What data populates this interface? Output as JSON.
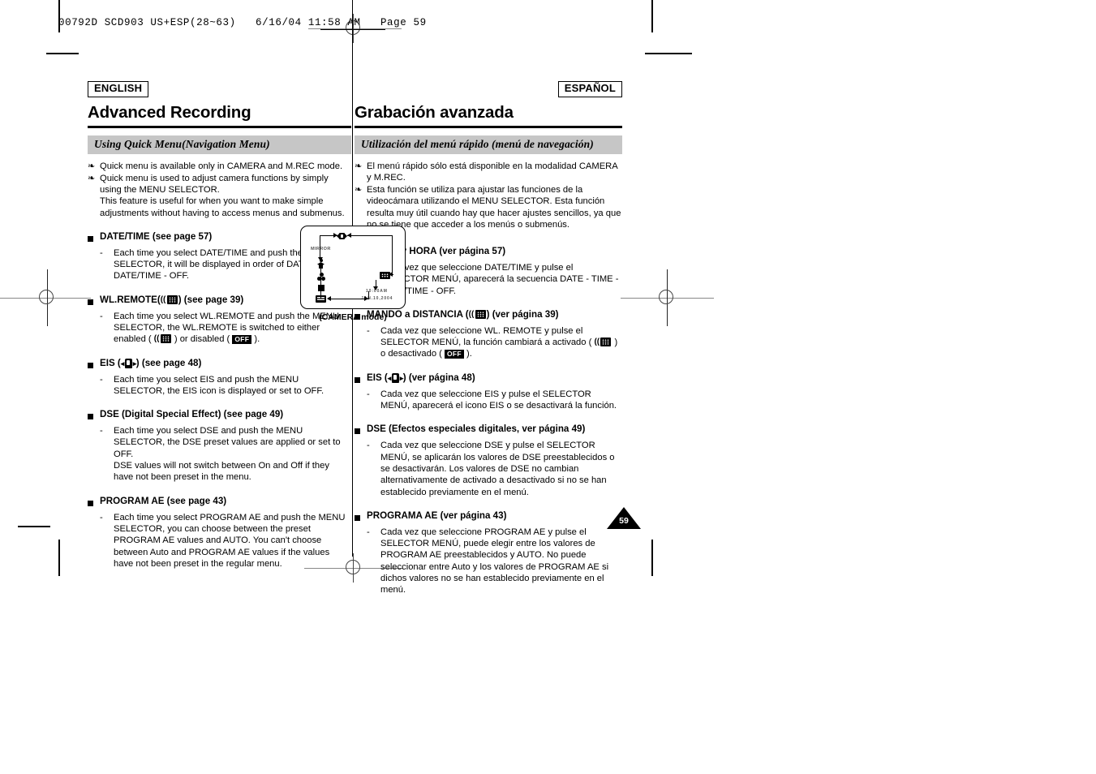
{
  "print_slug": {
    "text": "00792D SCD903 US+ESP(28~63)   6/16/04 11:58 AM   Page 59"
  },
  "english": {
    "lang_tag": "ENGLISH",
    "chapter_title": "Advanced Recording",
    "section_title": "Using Quick Menu(Navigation Menu)",
    "intro": [
      "Quick menu is available only in CAMERA and M.REC mode.",
      "Quick menu is used to adjust camera functions by simply using the MENU SELECTOR.\nThis feature is useful for when you want to make simple adjustments without having to access menus and submenus."
    ],
    "blocks": [
      {
        "heading_pre": "DATE/TIME (see page 57)",
        "heading_post": "",
        "icons": [],
        "body": "Each time you select DATE/TIME and push the MENU SELECTOR, it will be displayed in order of DATE - TIME - DATE/TIME - OFF."
      },
      {
        "heading_pre": "WL.REMOTE(",
        "heading_post": ") (see page 39)",
        "icons": [
          "remote-icon"
        ],
        "body_pre": "Each time you select WL.REMOTE and push the MENU SELECTOR, the WL.REMOTE is switched to either enabled (",
        "body_mid": ") or disabled (",
        "body_post": ").",
        "body": ""
      },
      {
        "heading_pre": "EIS (",
        "heading_post": ") (see page 48)",
        "icons": [
          "eis-icon"
        ],
        "body": "Each time you select EIS and push the MENU SELECTOR, the EIS icon is displayed or set to OFF."
      },
      {
        "heading_pre": "DSE (Digital Special Effect) (see page 49)",
        "heading_post": "",
        "icons": [],
        "body": "Each time you select DSE and push the MENU SELECTOR, the DSE preset values are applied or set to OFF.\nDSE values will not switch between On and Off if they have not been preset in the menu."
      },
      {
        "heading_pre": "PROGRAM AE (see page 43)",
        "heading_post": "",
        "icons": [],
        "body": "Each time you select PROGRAM AE and push the MENU SELECTOR, you can choose between the preset PROGRAM AE values and AUTO. You can't choose between Auto and PROGRAM AE values if the values have not been preset in the regular menu."
      }
    ]
  },
  "spanish": {
    "lang_tag": "ESPAÑOL",
    "chapter_title": "Grabación avanzada",
    "section_title": "Utilización del menú rápido (menú de navegación)",
    "intro": [
      "El menú rápido sólo está disponible en la modalidad CAMERA y M.REC.",
      "Esta función se utiliza para ajustar las funciones de la videocámara utilizando el MENU SELECTOR. Esta función resulta muy útil cuando hay que hacer ajustes sencillos, ya que no se tiene que acceder a los menús o submenús."
    ],
    "blocks": [
      {
        "heading_pre": "FECHA y HORA (ver página 57)",
        "heading_post": "",
        "icons": [],
        "body": "Cada vez que seleccione DATE/TIME y pulse el SELECTOR MENÚ, aparecerá la secuencia DATE - TIME - DATE/TIME - OFF."
      },
      {
        "heading_pre": "MANDO a DISTANCIA (",
        "heading_post": ") (ver página 39)",
        "icons": [
          "remote-icon"
        ],
        "body_pre": "Cada vez que seleccione WL. REMOTE y pulse el SELECTOR MENÚ, la función cambiará a activado (",
        "body_mid": ") o desactivado (",
        "body_post": ").",
        "body": ""
      },
      {
        "heading_pre": "EIS (",
        "heading_post": ") (ver página 48)",
        "icons": [
          "eis-icon"
        ],
        "body": "Cada vez que seleccione EIS y pulse el SELECTOR MENÚ, aparecerá el icono EIS o se desactivará la función."
      },
      {
        "heading_pre": "DSE (Efectos especiales digitales, ver página 49)",
        "heading_post": "",
        "icons": [],
        "body": "Cada vez que seleccione DSE y pulse el SELECTOR MENÚ, se aplicarán los valores de DSE preestablecidos o se desactivarán. Los valores de DSE no cambian alternativamente de activado a desactivado si no se han establecido previamente en el menú."
      },
      {
        "heading_pre": "PROGRAMA AE (ver página 43)",
        "heading_post": "",
        "icons": [],
        "body": "Cada vez que seleccione PROGRAM AE y pulse el SELECTOR MENÚ, puede elegir entre los valores de PROGRAM AE preestablecidos y AUTO. No puede seleccionar entre Auto y los valores de PROGRAM AE si dichos valores no se han establecido previamente en el menú."
      }
    ]
  },
  "viewfinder": {
    "caption": "(CAMERA mode)",
    "mirror_label": "MIRROR",
    "time_label": "10:00AM",
    "date_label": "JAN.10,2004",
    "icons": [
      "eis-icon",
      "person-icon",
      "dse-icon",
      "square-icon",
      "date-icon",
      "remote-icon"
    ]
  },
  "page_number": "59",
  "colors": {
    "section_bar_bg": "#c6c6c6",
    "text": "#000000",
    "paper": "#ffffff"
  }
}
